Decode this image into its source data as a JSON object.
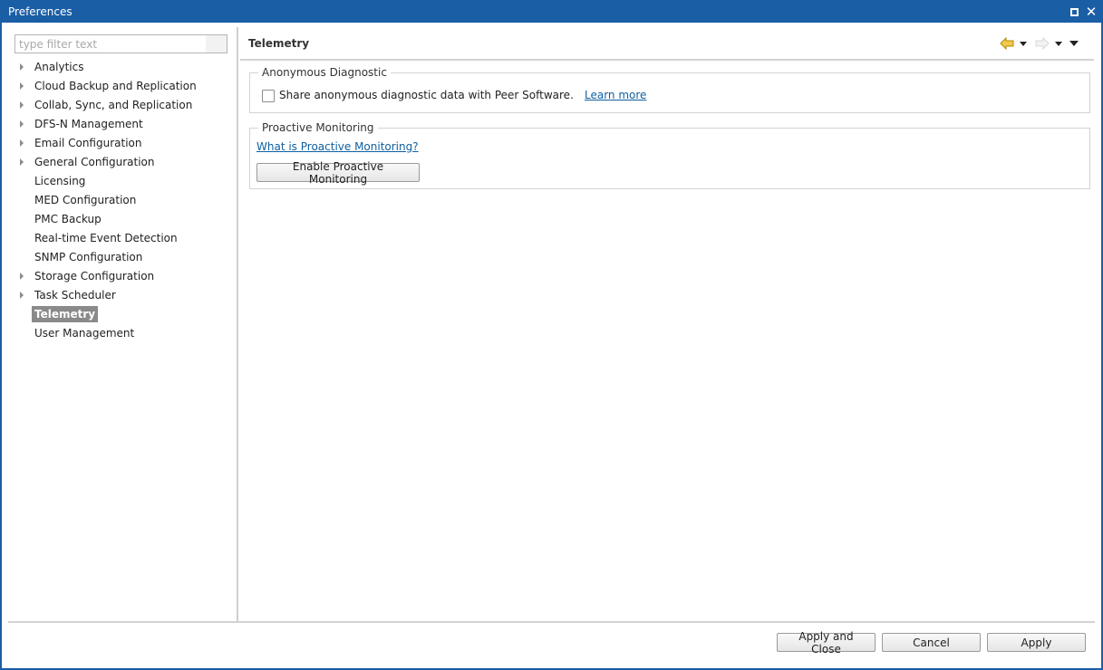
{
  "window": {
    "title": "Preferences"
  },
  "filter": {
    "placeholder": "type filter text",
    "value": ""
  },
  "tree": [
    {
      "label": "Analytics",
      "expandable": true
    },
    {
      "label": "Cloud Backup and Replication",
      "expandable": true
    },
    {
      "label": "Collab, Sync, and Replication",
      "expandable": true
    },
    {
      "label": "DFS-N Management",
      "expandable": true
    },
    {
      "label": "Email Configuration",
      "expandable": true
    },
    {
      "label": "General Configuration",
      "expandable": true
    },
    {
      "label": "Licensing",
      "expandable": false
    },
    {
      "label": "MED Configuration",
      "expandable": false
    },
    {
      "label": "PMC Backup",
      "expandable": false
    },
    {
      "label": "Real-time Event Detection",
      "expandable": false
    },
    {
      "label": "SNMP Configuration",
      "expandable": false
    },
    {
      "label": "Storage Configuration",
      "expandable": true
    },
    {
      "label": "Task Scheduler",
      "expandable": true
    },
    {
      "label": "Telemetry",
      "expandable": false,
      "selected": true
    },
    {
      "label": "User Management",
      "expandable": false
    }
  ],
  "page": {
    "title": "Telemetry"
  },
  "anonymous": {
    "legend": "Anonymous Diagnostic",
    "checkbox_label": "Share anonymous diagnostic data with Peer Software.",
    "checked": false,
    "learn_more": "Learn more"
  },
  "proactive": {
    "legend": "Proactive Monitoring",
    "link": "What is Proactive Monitoring?",
    "button": "Enable Proactive Monitoring"
  },
  "footer": {
    "apply_close": "Apply and Close",
    "cancel": "Cancel",
    "apply": "Apply"
  },
  "colors": {
    "titlebar": "#1a5ea6",
    "selection": "#8a8a8a",
    "link": "#0f5f9f",
    "back_arrow": "#e8b400"
  },
  "icons": {
    "back": "back-arrow-icon",
    "forward": "forward-arrow-icon",
    "menu": "view-menu-icon"
  }
}
